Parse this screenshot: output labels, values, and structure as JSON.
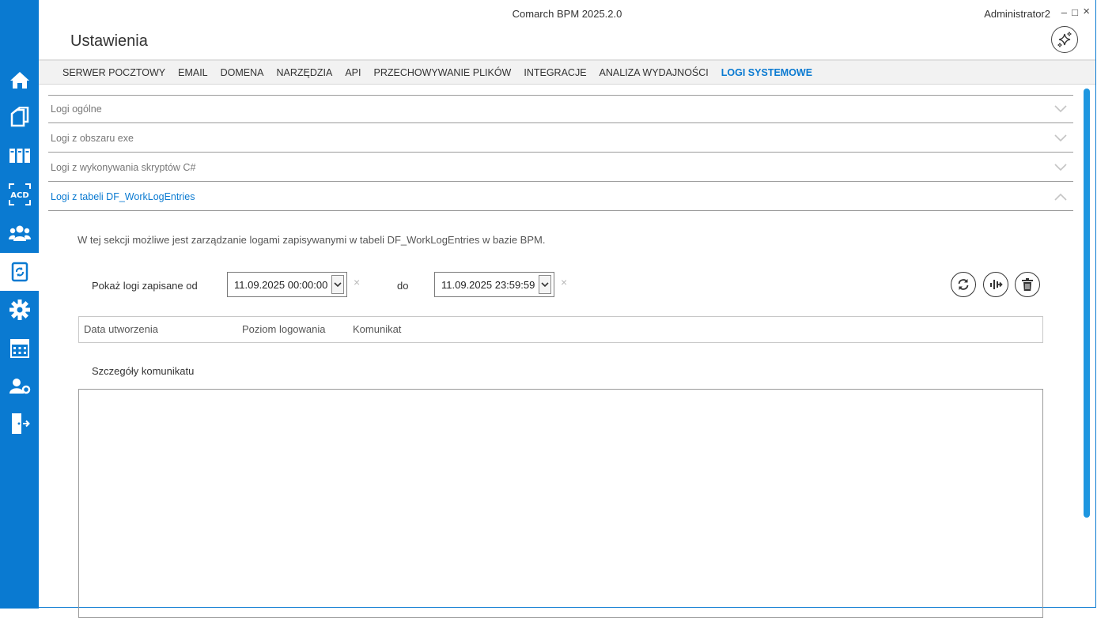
{
  "window": {
    "app_title": "Comarch BPM 2025.2.0",
    "user": "Administrator2",
    "minimize": "‒",
    "maximize": "□",
    "close": "×",
    "page_title": "Ustawienia"
  },
  "sidebar": {
    "items": [
      {
        "icon": "home-icon"
      },
      {
        "icon": "documents-icon"
      },
      {
        "icon": "binders-icon"
      },
      {
        "icon": "acd-icon",
        "text": "ACD"
      },
      {
        "icon": "users-icon"
      },
      {
        "icon": "settings-document-icon",
        "active": true
      },
      {
        "icon": "gear-icon"
      },
      {
        "icon": "calculator-icon"
      },
      {
        "icon": "user-settings-icon"
      },
      {
        "icon": "logout-icon"
      }
    ],
    "accent": "#0a7ad1"
  },
  "tabs": [
    {
      "label": "SERWER POCZTOWY"
    },
    {
      "label": "EMAIL"
    },
    {
      "label": "DOMENA"
    },
    {
      "label": "NARZĘDZIA"
    },
    {
      "label": "API"
    },
    {
      "label": "PRZECHOWYWANIE PLIKÓW"
    },
    {
      "label": "INTEGRACJE"
    },
    {
      "label": "ANALIZA WYDAJNOŚCI"
    },
    {
      "label": "LOGI SYSTEMOWE",
      "active": true
    }
  ],
  "accordion": [
    {
      "label": "Logi ogólne",
      "expanded": false
    },
    {
      "label": "Logi z obszaru exe",
      "expanded": false
    },
    {
      "label": "Logi z wykonywania skryptów C#",
      "expanded": false
    },
    {
      "label": "Logi z tabeli DF_WorkLogEntries",
      "expanded": true
    }
  ],
  "section": {
    "info": "W tej sekcji możliwe jest zarządzanie logami zapisywanymi w tabeli DF_WorkLogEntries w bazie BPM.",
    "from_label": "Pokaż logi zapisane od",
    "from_value": "11.09.2025 00:00:00",
    "to_label": "do",
    "to_value": "11.09.2025 23:59:59",
    "clear": "×",
    "columns": [
      "Data utworzenia",
      "Poziom logowania",
      "Komunikat"
    ],
    "details_label": "Szczegóły komunikatu",
    "actions": [
      "refresh-icon",
      "export-icon",
      "delete-icon"
    ]
  }
}
